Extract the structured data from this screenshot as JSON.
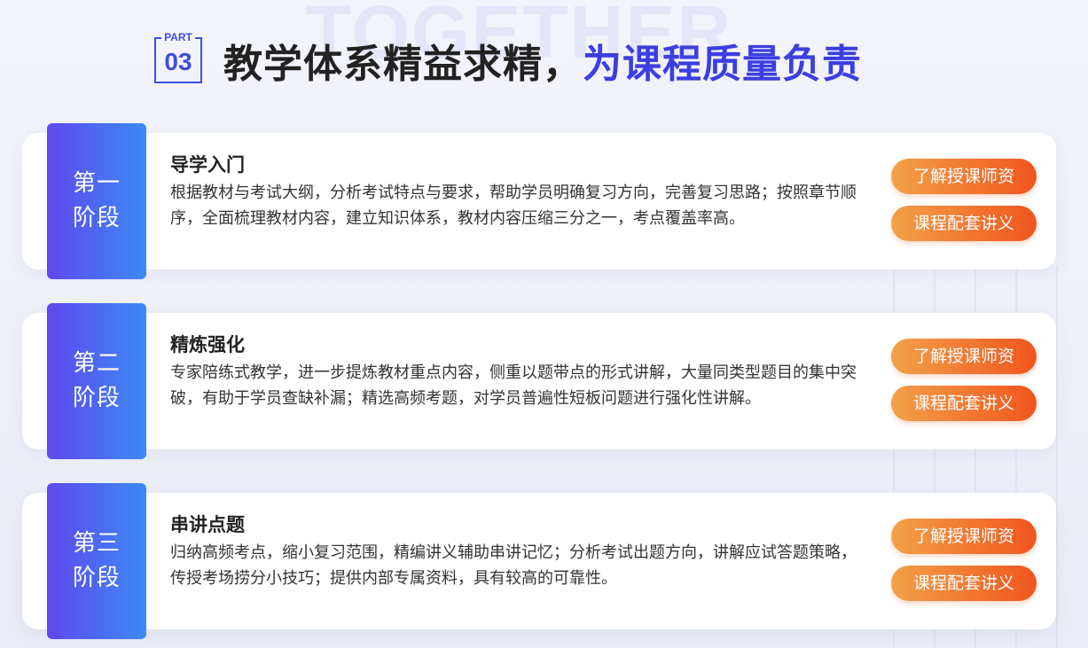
{
  "watermark": "TOGETHER",
  "header": {
    "part_label": "PART",
    "part_number": "03",
    "title_main": "教学体系精益求精，",
    "title_highlight": "为课程质量负责"
  },
  "stages": [
    {
      "label_line1": "第一",
      "label_line2": "阶段",
      "title": "导学入门",
      "description": "根据教材与考试大纲，分析考试特点与要求，帮助学员明确复习方向，完善复习思路；按照章节顺序，全面梳理教材内容，建立知识体系，教材内容压缩三分之一，考点覆盖率高。",
      "button_teacher": "了解授课师资",
      "button_notes": "课程配套讲义"
    },
    {
      "label_line1": "第二",
      "label_line2": "阶段",
      "title": "精炼强化",
      "description": "专家陪练式教学，进一步提炼教材重点内容，侧重以题带点的形式讲解，大量同类型题目的集中突破，有助于学员查缺补漏；精选高频考题，对学员普遍性短板问题进行强化性讲解。",
      "button_teacher": "了解授课师资",
      "button_notes": "课程配套讲义"
    },
    {
      "label_line1": "第三",
      "label_line2": "阶段",
      "title": "串讲点题",
      "description": "归纳高频考点，缩小复习范围，精编讲义辅助串讲记忆；分析考试出题方向，讲解应试答题策略，传授考场捞分小技巧；提供内部专属资料，具有较高的可靠性。",
      "button_teacher": "了解授课师资",
      "button_notes": "课程配套讲义"
    }
  ],
  "colors": {
    "accent_blue": "#3b3ee0",
    "stage_gradient_start": "#5e48f0",
    "stage_gradient_end": "#3d8af5",
    "button_gradient_start": "#f2a14a",
    "button_gradient_end": "#f0551d"
  }
}
